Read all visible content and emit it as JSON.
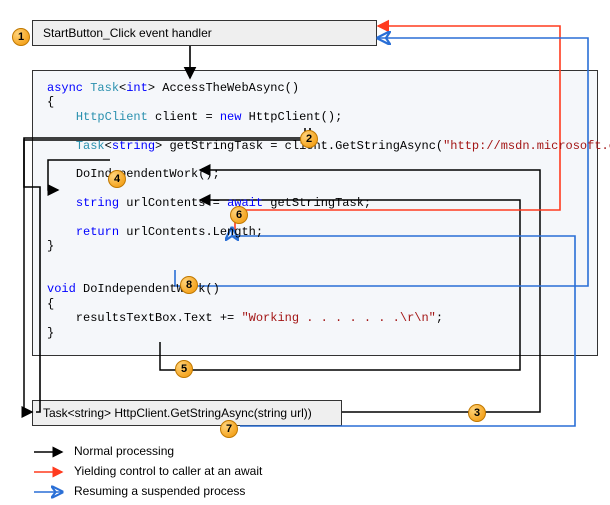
{
  "title_box": "StartButton_Click event handler",
  "code": {
    "sig_async": "async",
    "sig_task": "Task",
    "sig_int": "int",
    "sig_name": " AccessTheWebAsync()",
    "line_client_type": "HttpClient",
    "line_client_name": " client = ",
    "line_client_new": "new",
    "line_client_ctor": " HttpClient();",
    "gettask_task": "Task",
    "gettask_string": "string",
    "gettask_mid": " getStringTask = client.GetStringAsync(",
    "gettask_url": "\"http://msdn.microsoft.com\"",
    "gettask_end": ");",
    "indep_call": "DoIndependentWork();",
    "url_type": "string",
    "url_mid": " urlContents = ",
    "url_await": "await",
    "url_end": " getStringTask;",
    "ret_kw": "return",
    "ret_end": " urlContents.Length;",
    "void_kw": "void",
    "void_name": " DoIndependentWork()",
    "tb_line_a": "    resultsTextBox.Text += ",
    "tb_line_str": "\"Working . . . . . . .\\r\\n\"",
    "tb_line_end": ";"
  },
  "bottom_box": "Task<string> HttpClient.GetStringAsync(string url))",
  "badges": {
    "b1": "1",
    "b2": "2",
    "b3": "3",
    "b4": "4",
    "b5": "5",
    "b6": "6",
    "b7": "7",
    "b8": "8"
  },
  "legend": {
    "l1": "Normal processing",
    "l2": "Yielding control to caller at an await",
    "l3": "Resuming a suspended process"
  },
  "colors": {
    "normal": "#000000",
    "yield": "#ff3b1f",
    "resume": "#2a6fd6"
  }
}
